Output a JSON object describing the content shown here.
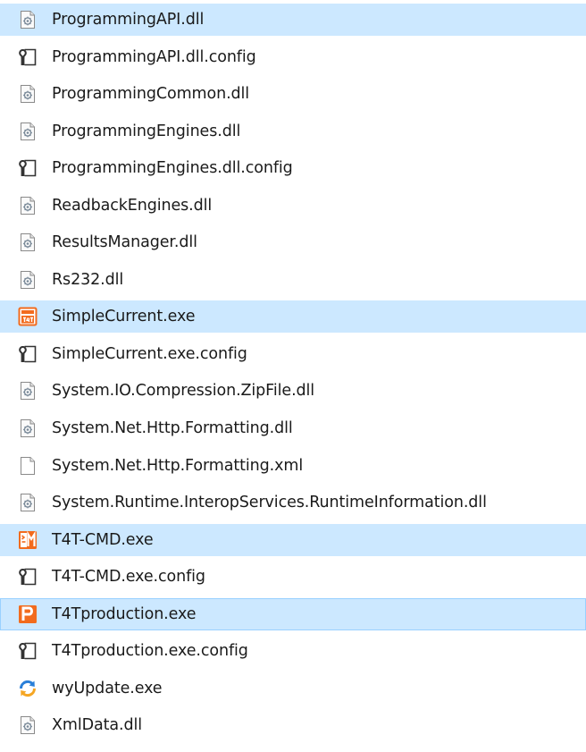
{
  "files": [
    {
      "name": "ProgrammingAPI.dll",
      "icon": "dll-file-icon",
      "selected": true
    },
    {
      "name": "ProgrammingAPI.dll.config",
      "icon": "config-file-icon",
      "selected": false
    },
    {
      "name": "ProgrammingCommon.dll",
      "icon": "dll-file-icon",
      "selected": false
    },
    {
      "name": "ProgrammingEngines.dll",
      "icon": "dll-file-icon",
      "selected": false
    },
    {
      "name": "ProgrammingEngines.dll.config",
      "icon": "config-file-icon",
      "selected": false
    },
    {
      "name": "ReadbackEngines.dll",
      "icon": "dll-file-icon",
      "selected": false
    },
    {
      "name": "ResultsManager.dll",
      "icon": "dll-file-icon",
      "selected": false
    },
    {
      "name": "Rs232.dll",
      "icon": "dll-file-icon",
      "selected": false
    },
    {
      "name": "SimpleCurrent.exe",
      "icon": "simplecurrent-app-icon",
      "selected": true
    },
    {
      "name": "SimpleCurrent.exe.config",
      "icon": "config-file-icon",
      "selected": false
    },
    {
      "name": "System.IO.Compression.ZipFile.dll",
      "icon": "dll-file-icon",
      "selected": false
    },
    {
      "name": "System.Net.Http.Formatting.dll",
      "icon": "dll-file-icon",
      "selected": false
    },
    {
      "name": "System.Net.Http.Formatting.xml",
      "icon": "blank-file-icon",
      "selected": false
    },
    {
      "name": "System.Runtime.InteropServices.RuntimeInformation.dll",
      "icon": "dll-file-icon",
      "selected": false
    },
    {
      "name": "T4T-CMD.exe",
      "icon": "t4t-cmd-app-icon",
      "selected": true
    },
    {
      "name": "T4T-CMD.exe.config",
      "icon": "config-file-icon",
      "selected": false
    },
    {
      "name": "T4Tproduction.exe",
      "icon": "t4tproduction-app-icon",
      "selected": true,
      "focused": true
    },
    {
      "name": "T4Tproduction.exe.config",
      "icon": "config-file-icon",
      "selected": false
    },
    {
      "name": "wyUpdate.exe",
      "icon": "update-arrows-icon",
      "selected": false
    },
    {
      "name": "XmlData.dll",
      "icon": "dll-file-icon",
      "selected": false
    }
  ],
  "colors": {
    "selection_background": "#cce8ff",
    "focus_border": "#99d1ff",
    "app_icon_orange": "#f26b1d",
    "update_icon_blue": "#2a7fd8",
    "update_icon_orange": "#f5a623"
  }
}
